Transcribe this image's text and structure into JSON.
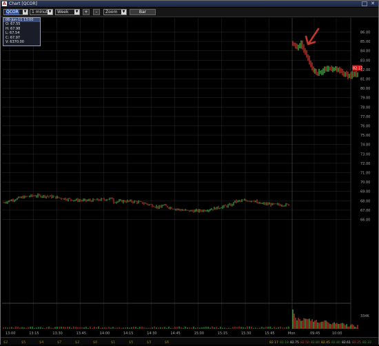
{
  "window": {
    "title": "Chart [QCOR]",
    "app_icon": "app-logo-icon",
    "title_color": "#e6e6e6"
  },
  "toolbar": {
    "symbol": "QCOR",
    "interval": "1 minute",
    "period": "Week",
    "zoom_in_label": "+",
    "zoom_out_label": "-",
    "zoom_label": "Zoom",
    "chart_style_label": "Bar"
  },
  "legend": {
    "header": "06-Jun-11 13:00",
    "open": "O: 67.55",
    "high": "H: 67.98",
    "low": "L: 67.54",
    "close": "C: 67.97",
    "volume": "V: 6370.00"
  },
  "status_bar": {
    "items": [
      "$2",
      "$5",
      "$4",
      "$7",
      "$2",
      "$0",
      "$1",
      "$5",
      "$3",
      "$6"
    ],
    "readouts": [
      "82.17",
      "82.18",
      "82.75",
      "82.50",
      "82.80",
      "82.45",
      "82.80",
      "82.61",
      "82.25",
      "82.33"
    ]
  },
  "colors": {
    "up": "#49c24a",
    "down": "#d63b2c",
    "grid": "#2a2a2a",
    "axis_text": "#a8a8a8",
    "price_marker": "#e01010",
    "arrow": "#c0392b"
  },
  "chart_data": {
    "type": "bar",
    "title": "",
    "xlabel": "",
    "ylabel": "",
    "price_axis": [
      "86.00",
      "85.00",
      "84.00",
      "83.00",
      "82.00",
      "81.00",
      "80.00",
      "79.00",
      "78.00",
      "77.00",
      "76.00",
      "75.00",
      "74.00",
      "73.00",
      "72.00",
      "71.00",
      "70.00",
      "69.00",
      "68.00",
      "67.00",
      "66.00"
    ],
    "volume_axis": [
      "334K"
    ],
    "time_axis": [
      "13:00",
      "13:15",
      "13:30",
      "13:45",
      "14:00",
      "14:15",
      "14:30",
      "14:45",
      "15:00",
      "15:15",
      "15:30",
      "15:45",
      "Mon",
      "09:45",
      "10:00"
    ],
    "ylim": [
      65.5,
      86.5
    ],
    "last_price": "82.17",
    "series": [
      {
        "session": "prior",
        "close_start": 67.8,
        "close_end": 67.9,
        "range": [
          67.5,
          68.8
        ]
      },
      {
        "session": "Mon",
        "open": 84.8,
        "high": 85.0,
        "low": 81.5,
        "close": 82.17
      }
    ],
    "annotation": "arrow pointing at Monday open bars",
    "grid": true
  }
}
